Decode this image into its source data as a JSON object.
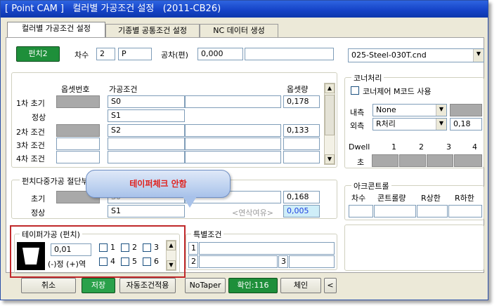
{
  "window": {
    "title": "[ Point CAM ]   컬러별 가공조건 설정   (2011-CB26)"
  },
  "tabs": [
    {
      "label": "컬러별 가공조건 설정",
      "active": true
    },
    {
      "label": "기종별 공통조건 설정",
      "active": false
    },
    {
      "label": "NC 데이터 생성",
      "active": false
    }
  ],
  "top": {
    "punch_button": "펀치2",
    "chasu_label": "차수",
    "chasu_value": "2",
    "chasu_code": "P",
    "gongcha_label": "공차(편)",
    "gongcha_value": "0,000",
    "file_combo": "025-Steel-030T.cnd"
  },
  "conditions": {
    "headers": {
      "offset_no": "옵셋번호",
      "condition": "가공조건",
      "offset_amount": "옵셋량"
    },
    "rows": [
      {
        "label": "1차 초기",
        "condition": "S0",
        "amount": "0,178"
      },
      {
        "label": "정상",
        "condition": "S1",
        "amount": ""
      },
      {
        "label": "2차 조건",
        "condition": "S2",
        "amount": "0,133"
      },
      {
        "label": "3차 조건",
        "condition": "",
        "amount": ""
      },
      {
        "label": "4차 조건",
        "condition": "",
        "amount": ""
      }
    ]
  },
  "multi": {
    "title": "펀치다중가공 절단부",
    "rows": [
      {
        "label": "초기",
        "condition": "S0",
        "amount": "0,168"
      },
      {
        "label": "정상",
        "condition": "S1",
        "amount": "0,005",
        "hint": "<연삭여유>"
      }
    ]
  },
  "callout": {
    "text": "테이퍼체크 안함"
  },
  "taper": {
    "title": "테이퍼가공 (펀치)",
    "value": "0,01",
    "sign_label": "(-)정 (+)역",
    "checks": [
      "1",
      "2",
      "3",
      "4",
      "5",
      "6"
    ]
  },
  "special": {
    "title": "특별조건",
    "numbers": [
      "1",
      "2",
      "3"
    ]
  },
  "corner": {
    "title": "코너처리",
    "mcode_label": "코너제어 M코드 사용",
    "inner_label": "내측",
    "inner_value": "None",
    "outer_label": "외측",
    "outer_value": "R처리",
    "outer_number": "0,18",
    "dwell_label": "Dwell",
    "dwell_cols": [
      "1",
      "2",
      "3",
      "4"
    ],
    "sec_label": "초"
  },
  "arc": {
    "title": "아크콘트롤",
    "headers": [
      "차수",
      "콘트롤량",
      "R상한",
      "R하한"
    ]
  },
  "bottom": {
    "cancel": "취소",
    "save": "저장",
    "auto_apply": "자동조건적용",
    "no_taper": "NoTaper",
    "confirm": "확인:116",
    "chain": "체인",
    "back": "<"
  },
  "colors": {
    "accent_green": "#1e8f3a",
    "title_blue": "#1644c8",
    "callout_text": "#e0201c",
    "highlight_box": "#c0282a"
  }
}
